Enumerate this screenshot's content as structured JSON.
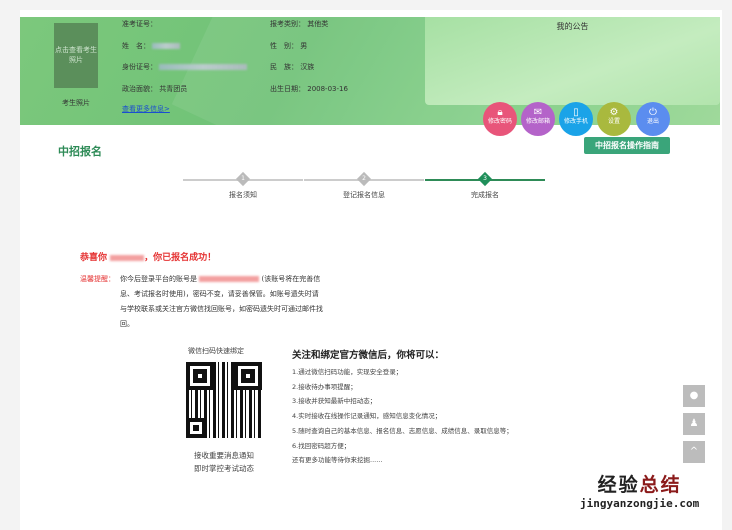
{
  "header": {
    "photo_button": "点击查看考生照片",
    "photo_label": "考生照片",
    "fields": [
      {
        "label": "准考证号：",
        "value": ""
      },
      {
        "label": "姓　名：",
        "value": ""
      },
      {
        "label": "身份证号：",
        "value": ""
      },
      {
        "label": "政治面貌：",
        "value": "共青团员"
      },
      {
        "label": "报考类别：",
        "value": "其他类"
      },
      {
        "label": "性　别：",
        "value": "男"
      },
      {
        "label": "民　族：",
        "value": "汉族"
      },
      {
        "label": "出生日期：",
        "value": "2008-03-16"
      }
    ],
    "more_link": "查看更多信息>",
    "notice_title": "我的公告",
    "actions": [
      {
        "label": "修改密码",
        "icon": "lock-icon",
        "color": "#e8557a"
      },
      {
        "label": "修改邮箱",
        "icon": "mail-icon",
        "color": "#b463c9"
      },
      {
        "label": "修改手机",
        "icon": "phone-icon",
        "color": "#1aa3e8"
      },
      {
        "label": "设置",
        "icon": "gear-icon",
        "color": "#a9b93e"
      },
      {
        "label": "退出",
        "icon": "power-icon",
        "color": "#5b8def"
      }
    ],
    "guide_button": "中招报名操作指南"
  },
  "main": {
    "title": "中招报名",
    "steps": [
      {
        "num": "1",
        "label": "报名须知"
      },
      {
        "num": "2",
        "label": "登记报名信息"
      },
      {
        "num": "3",
        "label": "完成报名"
      }
    ],
    "current_step": 3,
    "success_prefix": "恭喜你 ",
    "success_suffix": "，你已报名成功！",
    "tip_label": "温馨提醒：",
    "tip_text_1": "你今后登录平台的账号是 ",
    "tip_text_2": " (该账号将在完善信息、考试报名时使用)，密码不变，请妥善保管。如账号遗失时请与学校联系或关注官方微信找回账号，如密码遗失时可通过邮件找回。",
    "qr_title": "微信扫码快速绑定",
    "qr_caption_1": "接收重要消息通知",
    "qr_caption_2": "即时掌控考试动态",
    "benefits_title": "关注和绑定官方微信后，你将可以：",
    "benefits": [
      "1.通过微信扫码功能，实现安全登录；",
      "2.接收待办事项提醒；",
      "3.接收并获知最新中招动态；",
      "4.实时接收在线操作记录通知，感知信息变化情况；",
      "5.随时查询自己的基本信息、报名信息、志愿信息、成绩信息、录取信息等；",
      "6.找回密码超方便；",
      "还有更多功能等待你来挖掘......"
    ]
  },
  "side": [
    {
      "icon": "wechat-icon"
    },
    {
      "icon": "qq-icon"
    },
    {
      "icon": "back-to-top-icon",
      "label": "^"
    }
  ],
  "watermark": {
    "cn_1": "经验",
    "cn_2": "总结",
    "en": "jingyanzongjie.com"
  }
}
